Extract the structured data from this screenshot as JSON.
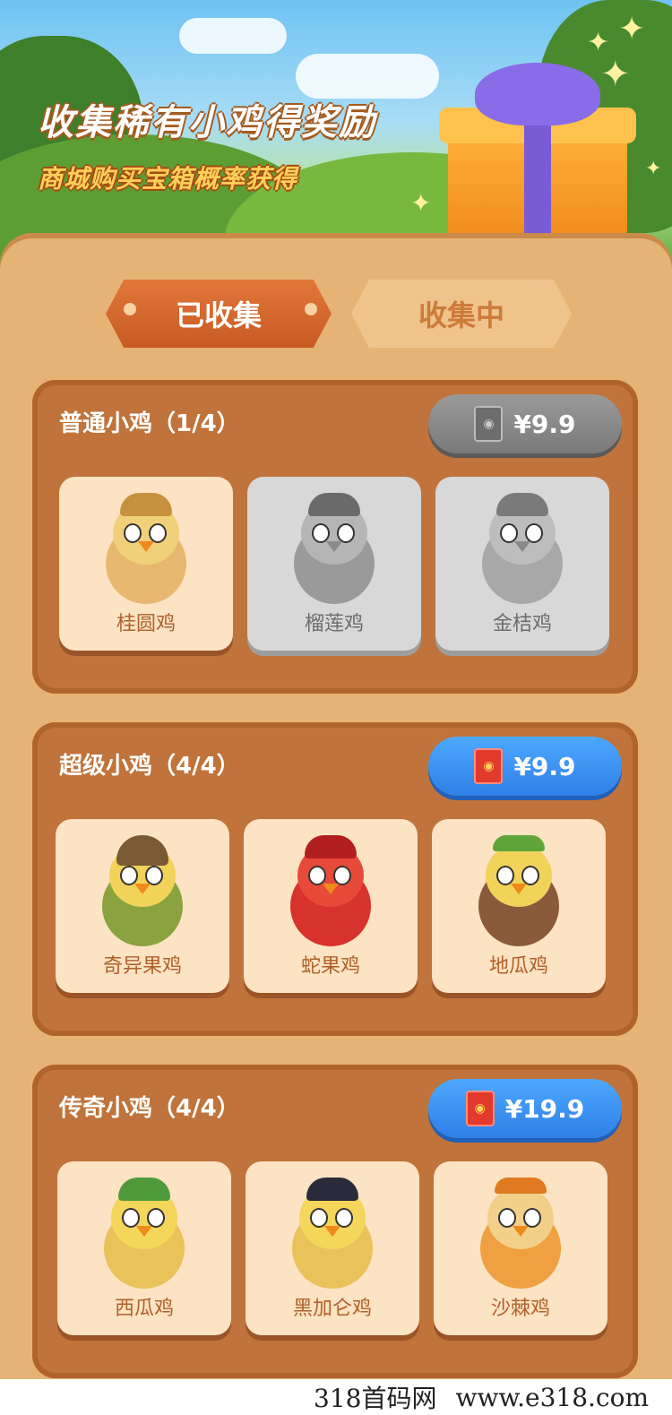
{
  "header": {
    "headline": "收集稀有小鸡得奖励",
    "subline": "商城购买宝箱概率获得"
  },
  "tabs": [
    {
      "label": "已收集",
      "active": true
    },
    {
      "label": "收集中",
      "active": false
    }
  ],
  "sections": [
    {
      "title": "普通小鸡（1/4）",
      "price": "¥9.9",
      "button_style": "gray",
      "items": [
        {
          "name": "桂圆鸡",
          "collected": true,
          "color": "#e8b870",
          "hat": "#c8913e"
        },
        {
          "name": "榴莲鸡",
          "collected": false,
          "color": "#9a9a9a",
          "hat": "#6a6a6a"
        },
        {
          "name": "金桔鸡",
          "collected": false,
          "color": "#a8a8a8",
          "hat": "#7a7a7a"
        }
      ]
    },
    {
      "title": "超级小鸡（4/4）",
      "price": "¥9.9",
      "button_style": "blue",
      "items": [
        {
          "name": "奇异果鸡",
          "collected": true,
          "color": "#8aa33e",
          "hat": "#7a5a34"
        },
        {
          "name": "蛇果鸡",
          "collected": true,
          "color": "#d8322c",
          "hat": "#b21f1f"
        },
        {
          "name": "地瓜鸡",
          "collected": true,
          "color": "#f1d35a",
          "hat": "#8a5a3a"
        }
      ]
    },
    {
      "title": "传奇小鸡（4/4）",
      "price": "¥19.9",
      "button_style": "blue",
      "items": [
        {
          "name": "西瓜鸡",
          "collected": true,
          "color": "#f3d65a",
          "hat": "#4e9a3a"
        },
        {
          "name": "黑加仑鸡",
          "collected": true,
          "color": "#f3d65a",
          "hat": "#2a2a3a"
        },
        {
          "name": "沙棘鸡",
          "collected": true,
          "color": "#f0a040",
          "hat": "#e07a20"
        }
      ]
    }
  ],
  "watermark": {
    "left": "318首码网",
    "right": "www.e318.com"
  }
}
